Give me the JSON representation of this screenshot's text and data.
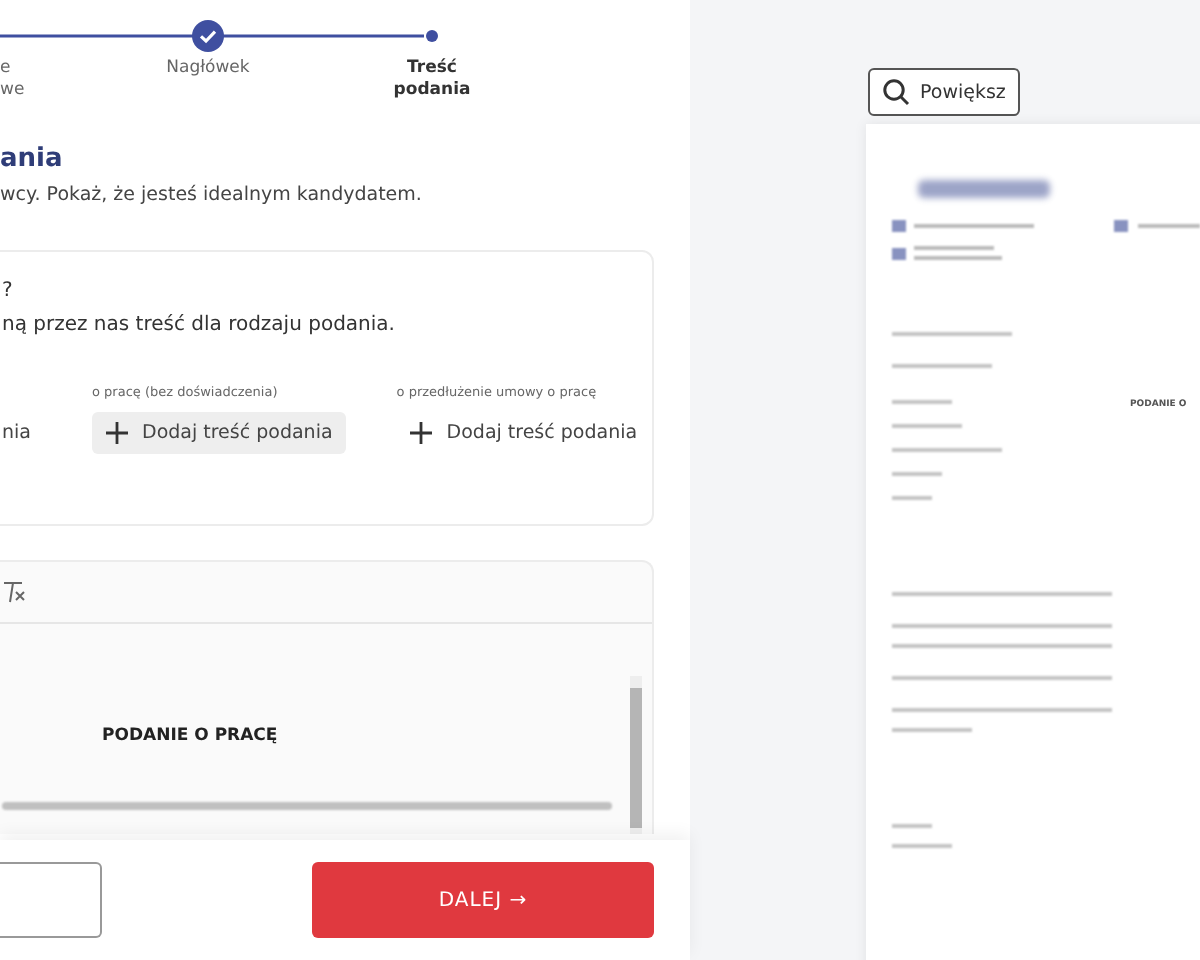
{
  "stepper": {
    "steps": [
      {
        "lines": [
          "e",
          "we"
        ],
        "current": false
      },
      {
        "lines": [
          "Nagłówek"
        ],
        "current": false
      },
      {
        "lines": [
          "Treść",
          "podania"
        ],
        "current": true
      }
    ]
  },
  "section": {
    "title": "ania",
    "subtitle": "wcy. Pokaż, że jesteś idealnym kandydatem."
  },
  "templates_card": {
    "question": "?",
    "hint": "ną przez nas treść dla rodzaju podania.",
    "options": [
      {
        "kind": "partial",
        "button": "nia",
        "hovered": false
      },
      {
        "kind": "full",
        "label": "o pracę (bez doświadczenia)",
        "button": "Dodaj treść podania",
        "hovered": true
      },
      {
        "kind": "full",
        "label": "o przedłużenie umowy o pracę",
        "button": "Dodaj treść podania",
        "hovered": false
      }
    ]
  },
  "editor": {
    "heading": "PODANIE O PRACĘ"
  },
  "footer": {
    "next_button": "DALEJ →"
  },
  "preview": {
    "zoom_button": "Powiększ",
    "doc_heading": "PODANIE O"
  }
}
